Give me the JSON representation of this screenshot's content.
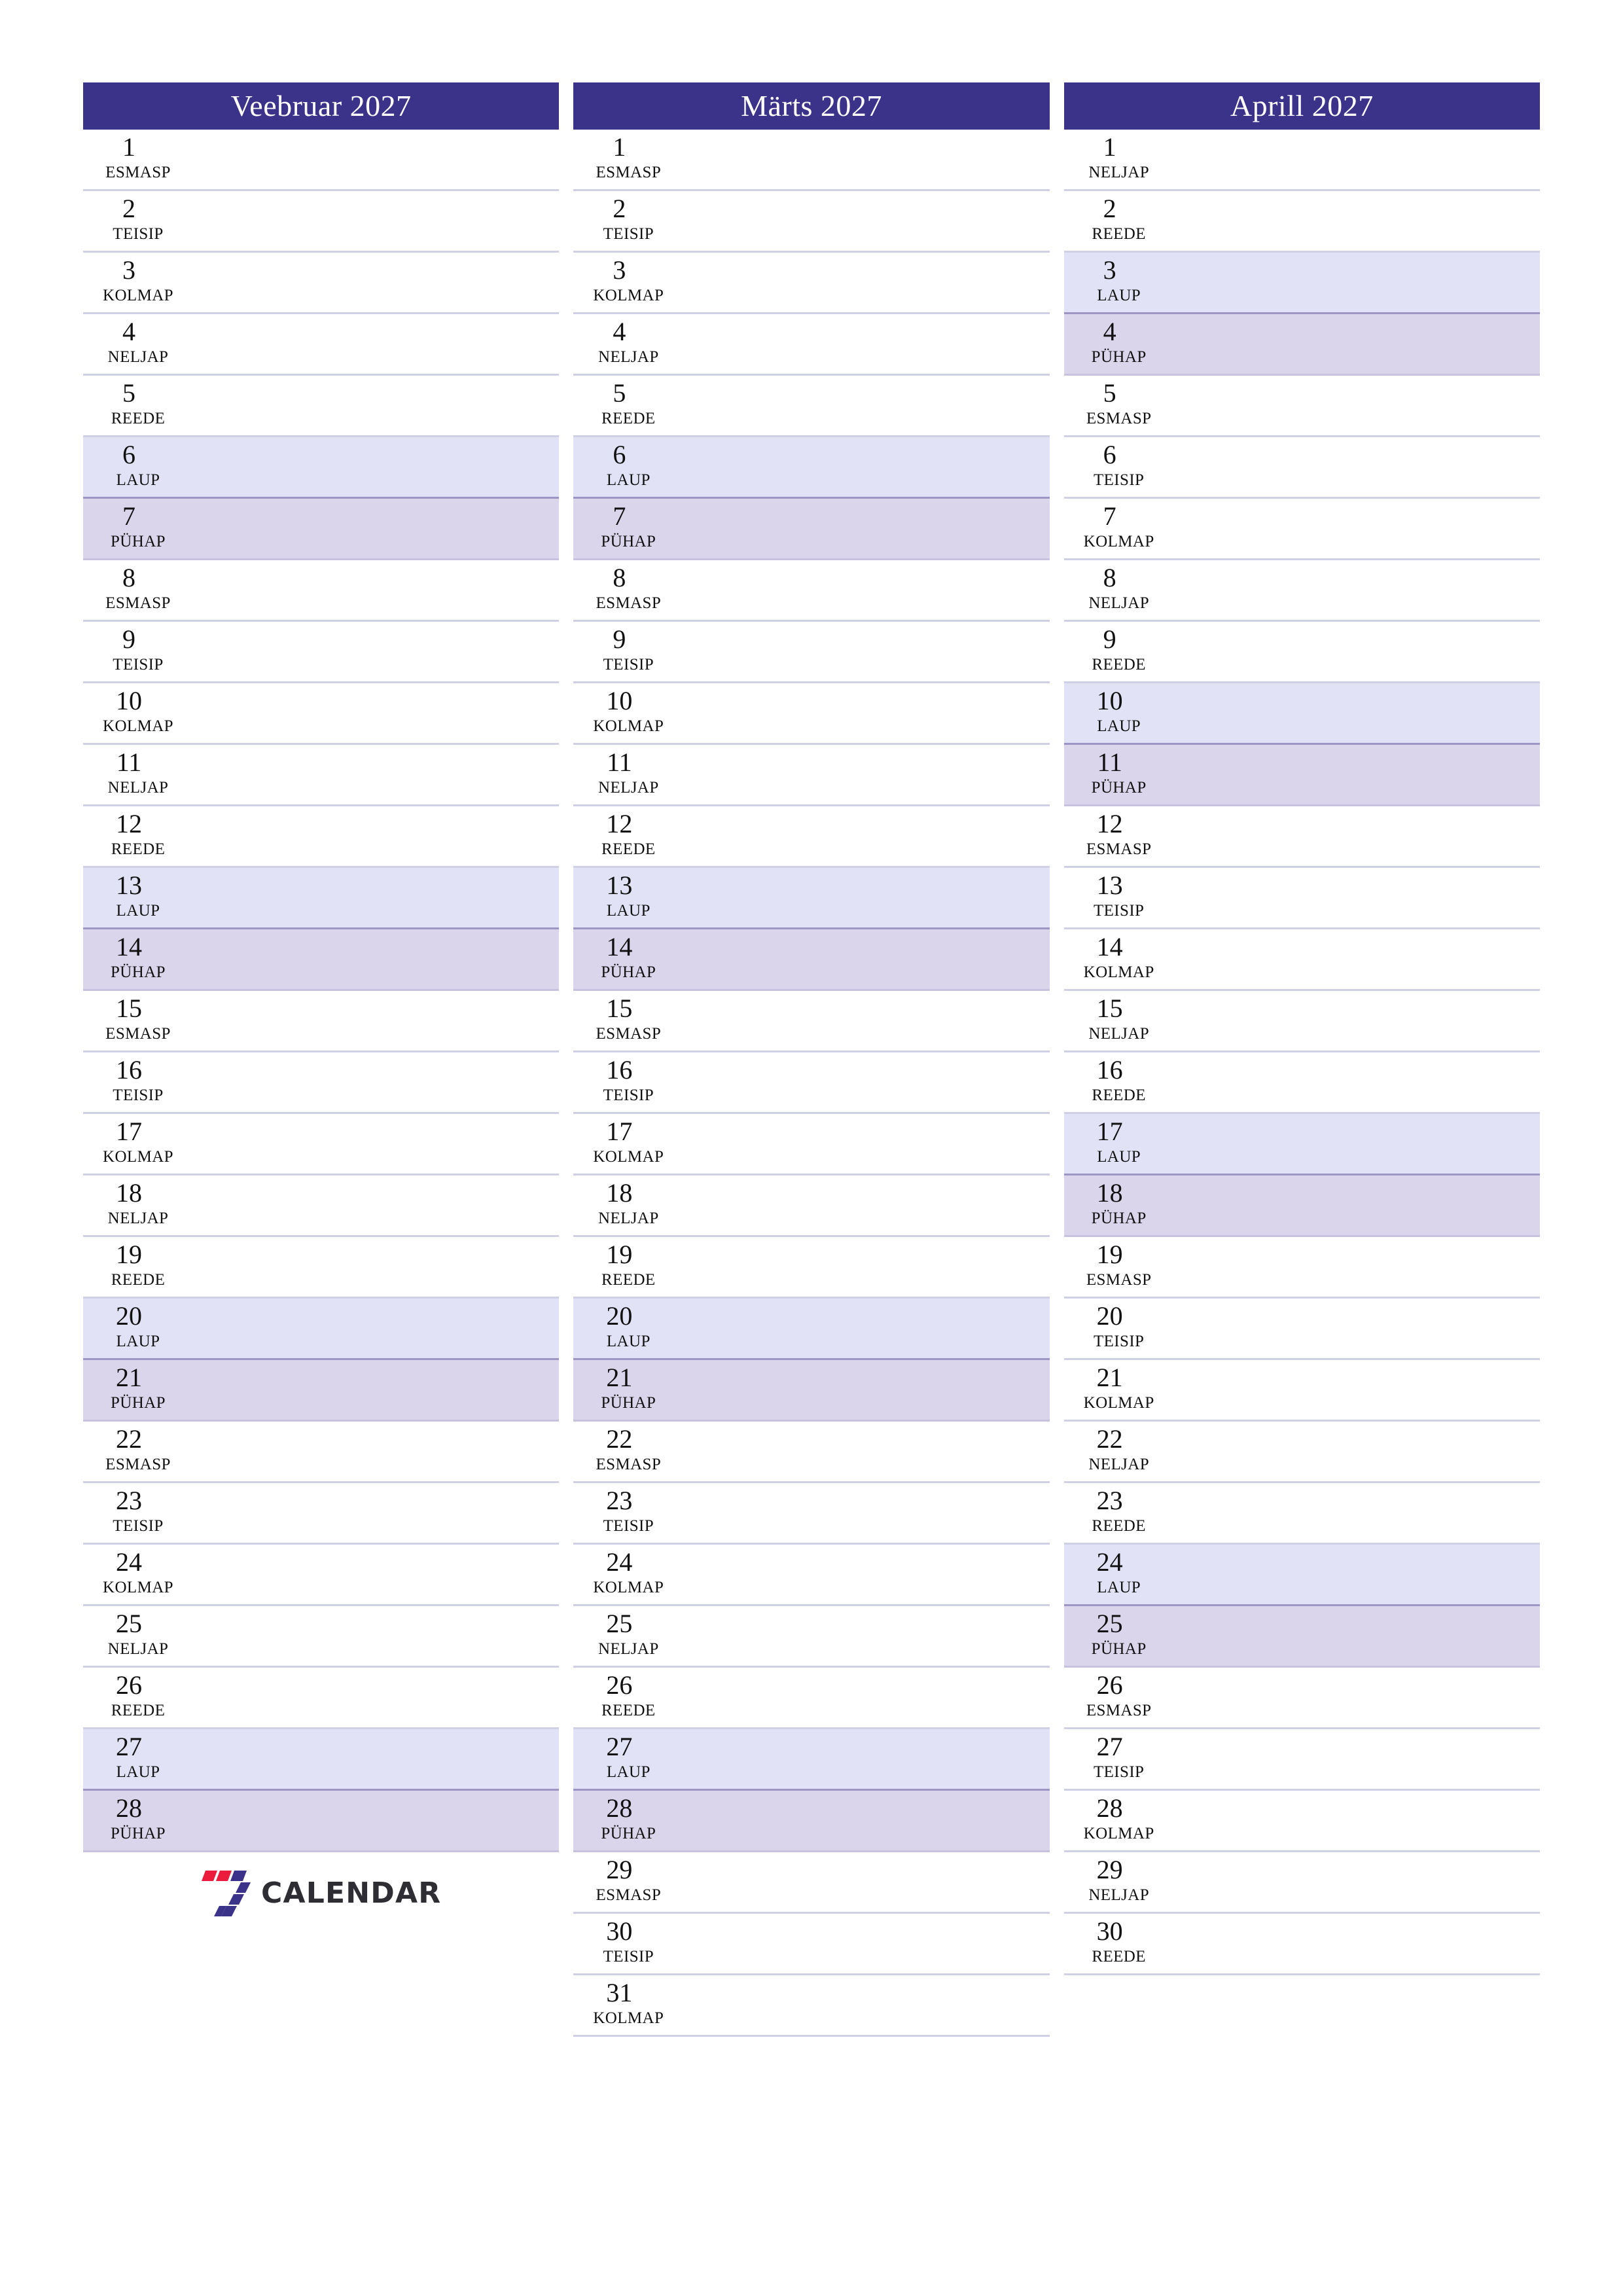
{
  "document": {
    "type": "monthly-planner",
    "language": "et",
    "year": "2027"
  },
  "colors": {
    "header_bar": "#3B3289",
    "header_text": "#FFFFFF",
    "saturday_bg": "#E2E2F6",
    "sunday_bg": "#DBD5EC",
    "row_divider": "#CFCFE6",
    "day_text": "#111111",
    "logo_red": "#EC1C3C",
    "logo_blue": "#3B3289",
    "logo_word": "#2D2D33"
  },
  "weekday_names": {
    "mon": "ESMASP",
    "tue": "TEISIP",
    "wed": "KOLMAP",
    "thu": "NELJAP",
    "fri": "REEDE",
    "sat": "LAUP",
    "sun": "PÜHAP"
  },
  "logo": {
    "mark_name": "seven-calendar-logo-icon",
    "wordmark": "CALENDAR"
  },
  "months": [
    {
      "title": "Veebruar 2027",
      "days": [
        {
          "num": "1",
          "name": "ESMASP",
          "kind": "weekday"
        },
        {
          "num": "2",
          "name": "TEISIP",
          "kind": "weekday"
        },
        {
          "num": "3",
          "name": "KOLMAP",
          "kind": "weekday"
        },
        {
          "num": "4",
          "name": "NELJAP",
          "kind": "weekday"
        },
        {
          "num": "5",
          "name": "REEDE",
          "kind": "weekday"
        },
        {
          "num": "6",
          "name": "LAUP",
          "kind": "sat"
        },
        {
          "num": "7",
          "name": "PÜHAP",
          "kind": "sun"
        },
        {
          "num": "8",
          "name": "ESMASP",
          "kind": "weekday"
        },
        {
          "num": "9",
          "name": "TEISIP",
          "kind": "weekday"
        },
        {
          "num": "10",
          "name": "KOLMAP",
          "kind": "weekday"
        },
        {
          "num": "11",
          "name": "NELJAP",
          "kind": "weekday"
        },
        {
          "num": "12",
          "name": "REEDE",
          "kind": "weekday"
        },
        {
          "num": "13",
          "name": "LAUP",
          "kind": "sat"
        },
        {
          "num": "14",
          "name": "PÜHAP",
          "kind": "sun"
        },
        {
          "num": "15",
          "name": "ESMASP",
          "kind": "weekday"
        },
        {
          "num": "16",
          "name": "TEISIP",
          "kind": "weekday"
        },
        {
          "num": "17",
          "name": "KOLMAP",
          "kind": "weekday"
        },
        {
          "num": "18",
          "name": "NELJAP",
          "kind": "weekday"
        },
        {
          "num": "19",
          "name": "REEDE",
          "kind": "weekday"
        },
        {
          "num": "20",
          "name": "LAUP",
          "kind": "sat"
        },
        {
          "num": "21",
          "name": "PÜHAP",
          "kind": "sun"
        },
        {
          "num": "22",
          "name": "ESMASP",
          "kind": "weekday"
        },
        {
          "num": "23",
          "name": "TEISIP",
          "kind": "weekday"
        },
        {
          "num": "24",
          "name": "KOLMAP",
          "kind": "weekday"
        },
        {
          "num": "25",
          "name": "NELJAP",
          "kind": "weekday"
        },
        {
          "num": "26",
          "name": "REEDE",
          "kind": "weekday"
        },
        {
          "num": "27",
          "name": "LAUP",
          "kind": "sat"
        },
        {
          "num": "28",
          "name": "PÜHAP",
          "kind": "sun"
        }
      ]
    },
    {
      "title": "Märts 2027",
      "days": [
        {
          "num": "1",
          "name": "ESMASP",
          "kind": "weekday"
        },
        {
          "num": "2",
          "name": "TEISIP",
          "kind": "weekday"
        },
        {
          "num": "3",
          "name": "KOLMAP",
          "kind": "weekday"
        },
        {
          "num": "4",
          "name": "NELJAP",
          "kind": "weekday"
        },
        {
          "num": "5",
          "name": "REEDE",
          "kind": "weekday"
        },
        {
          "num": "6",
          "name": "LAUP",
          "kind": "sat"
        },
        {
          "num": "7",
          "name": "PÜHAP",
          "kind": "sun"
        },
        {
          "num": "8",
          "name": "ESMASP",
          "kind": "weekday"
        },
        {
          "num": "9",
          "name": "TEISIP",
          "kind": "weekday"
        },
        {
          "num": "10",
          "name": "KOLMAP",
          "kind": "weekday"
        },
        {
          "num": "11",
          "name": "NELJAP",
          "kind": "weekday"
        },
        {
          "num": "12",
          "name": "REEDE",
          "kind": "weekday"
        },
        {
          "num": "13",
          "name": "LAUP",
          "kind": "sat"
        },
        {
          "num": "14",
          "name": "PÜHAP",
          "kind": "sun"
        },
        {
          "num": "15",
          "name": "ESMASP",
          "kind": "weekday"
        },
        {
          "num": "16",
          "name": "TEISIP",
          "kind": "weekday"
        },
        {
          "num": "17",
          "name": "KOLMAP",
          "kind": "weekday"
        },
        {
          "num": "18",
          "name": "NELJAP",
          "kind": "weekday"
        },
        {
          "num": "19",
          "name": "REEDE",
          "kind": "weekday"
        },
        {
          "num": "20",
          "name": "LAUP",
          "kind": "sat"
        },
        {
          "num": "21",
          "name": "PÜHAP",
          "kind": "sun"
        },
        {
          "num": "22",
          "name": "ESMASP",
          "kind": "weekday"
        },
        {
          "num": "23",
          "name": "TEISIP",
          "kind": "weekday"
        },
        {
          "num": "24",
          "name": "KOLMAP",
          "kind": "weekday"
        },
        {
          "num": "25",
          "name": "NELJAP",
          "kind": "weekday"
        },
        {
          "num": "26",
          "name": "REEDE",
          "kind": "weekday"
        },
        {
          "num": "27",
          "name": "LAUP",
          "kind": "sat"
        },
        {
          "num": "28",
          "name": "PÜHAP",
          "kind": "sun"
        },
        {
          "num": "29",
          "name": "ESMASP",
          "kind": "weekday"
        },
        {
          "num": "30",
          "name": "TEISIP",
          "kind": "weekday"
        },
        {
          "num": "31",
          "name": "KOLMAP",
          "kind": "weekday"
        }
      ]
    },
    {
      "title": "Aprill 2027",
      "days": [
        {
          "num": "1",
          "name": "NELJAP",
          "kind": "weekday"
        },
        {
          "num": "2",
          "name": "REEDE",
          "kind": "weekday"
        },
        {
          "num": "3",
          "name": "LAUP",
          "kind": "sat"
        },
        {
          "num": "4",
          "name": "PÜHAP",
          "kind": "sun"
        },
        {
          "num": "5",
          "name": "ESMASP",
          "kind": "weekday"
        },
        {
          "num": "6",
          "name": "TEISIP",
          "kind": "weekday"
        },
        {
          "num": "7",
          "name": "KOLMAP",
          "kind": "weekday"
        },
        {
          "num": "8",
          "name": "NELJAP",
          "kind": "weekday"
        },
        {
          "num": "9",
          "name": "REEDE",
          "kind": "weekday"
        },
        {
          "num": "10",
          "name": "LAUP",
          "kind": "sat"
        },
        {
          "num": "11",
          "name": "PÜHAP",
          "kind": "sun"
        },
        {
          "num": "12",
          "name": "ESMASP",
          "kind": "weekday"
        },
        {
          "num": "13",
          "name": "TEISIP",
          "kind": "weekday"
        },
        {
          "num": "14",
          "name": "KOLMAP",
          "kind": "weekday"
        },
        {
          "num": "15",
          "name": "NELJAP",
          "kind": "weekday"
        },
        {
          "num": "16",
          "name": "REEDE",
          "kind": "weekday"
        },
        {
          "num": "17",
          "name": "LAUP",
          "kind": "sat"
        },
        {
          "num": "18",
          "name": "PÜHAP",
          "kind": "sun"
        },
        {
          "num": "19",
          "name": "ESMASP",
          "kind": "weekday"
        },
        {
          "num": "20",
          "name": "TEISIP",
          "kind": "weekday"
        },
        {
          "num": "21",
          "name": "KOLMAP",
          "kind": "weekday"
        },
        {
          "num": "22",
          "name": "NELJAP",
          "kind": "weekday"
        },
        {
          "num": "23",
          "name": "REEDE",
          "kind": "weekday"
        },
        {
          "num": "24",
          "name": "LAUP",
          "kind": "sat"
        },
        {
          "num": "25",
          "name": "PÜHAP",
          "kind": "sun"
        },
        {
          "num": "26",
          "name": "ESMASP",
          "kind": "weekday"
        },
        {
          "num": "27",
          "name": "TEISIP",
          "kind": "weekday"
        },
        {
          "num": "28",
          "name": "KOLMAP",
          "kind": "weekday"
        },
        {
          "num": "29",
          "name": "NELJAP",
          "kind": "weekday"
        },
        {
          "num": "30",
          "name": "REEDE",
          "kind": "weekday"
        }
      ]
    }
  ]
}
